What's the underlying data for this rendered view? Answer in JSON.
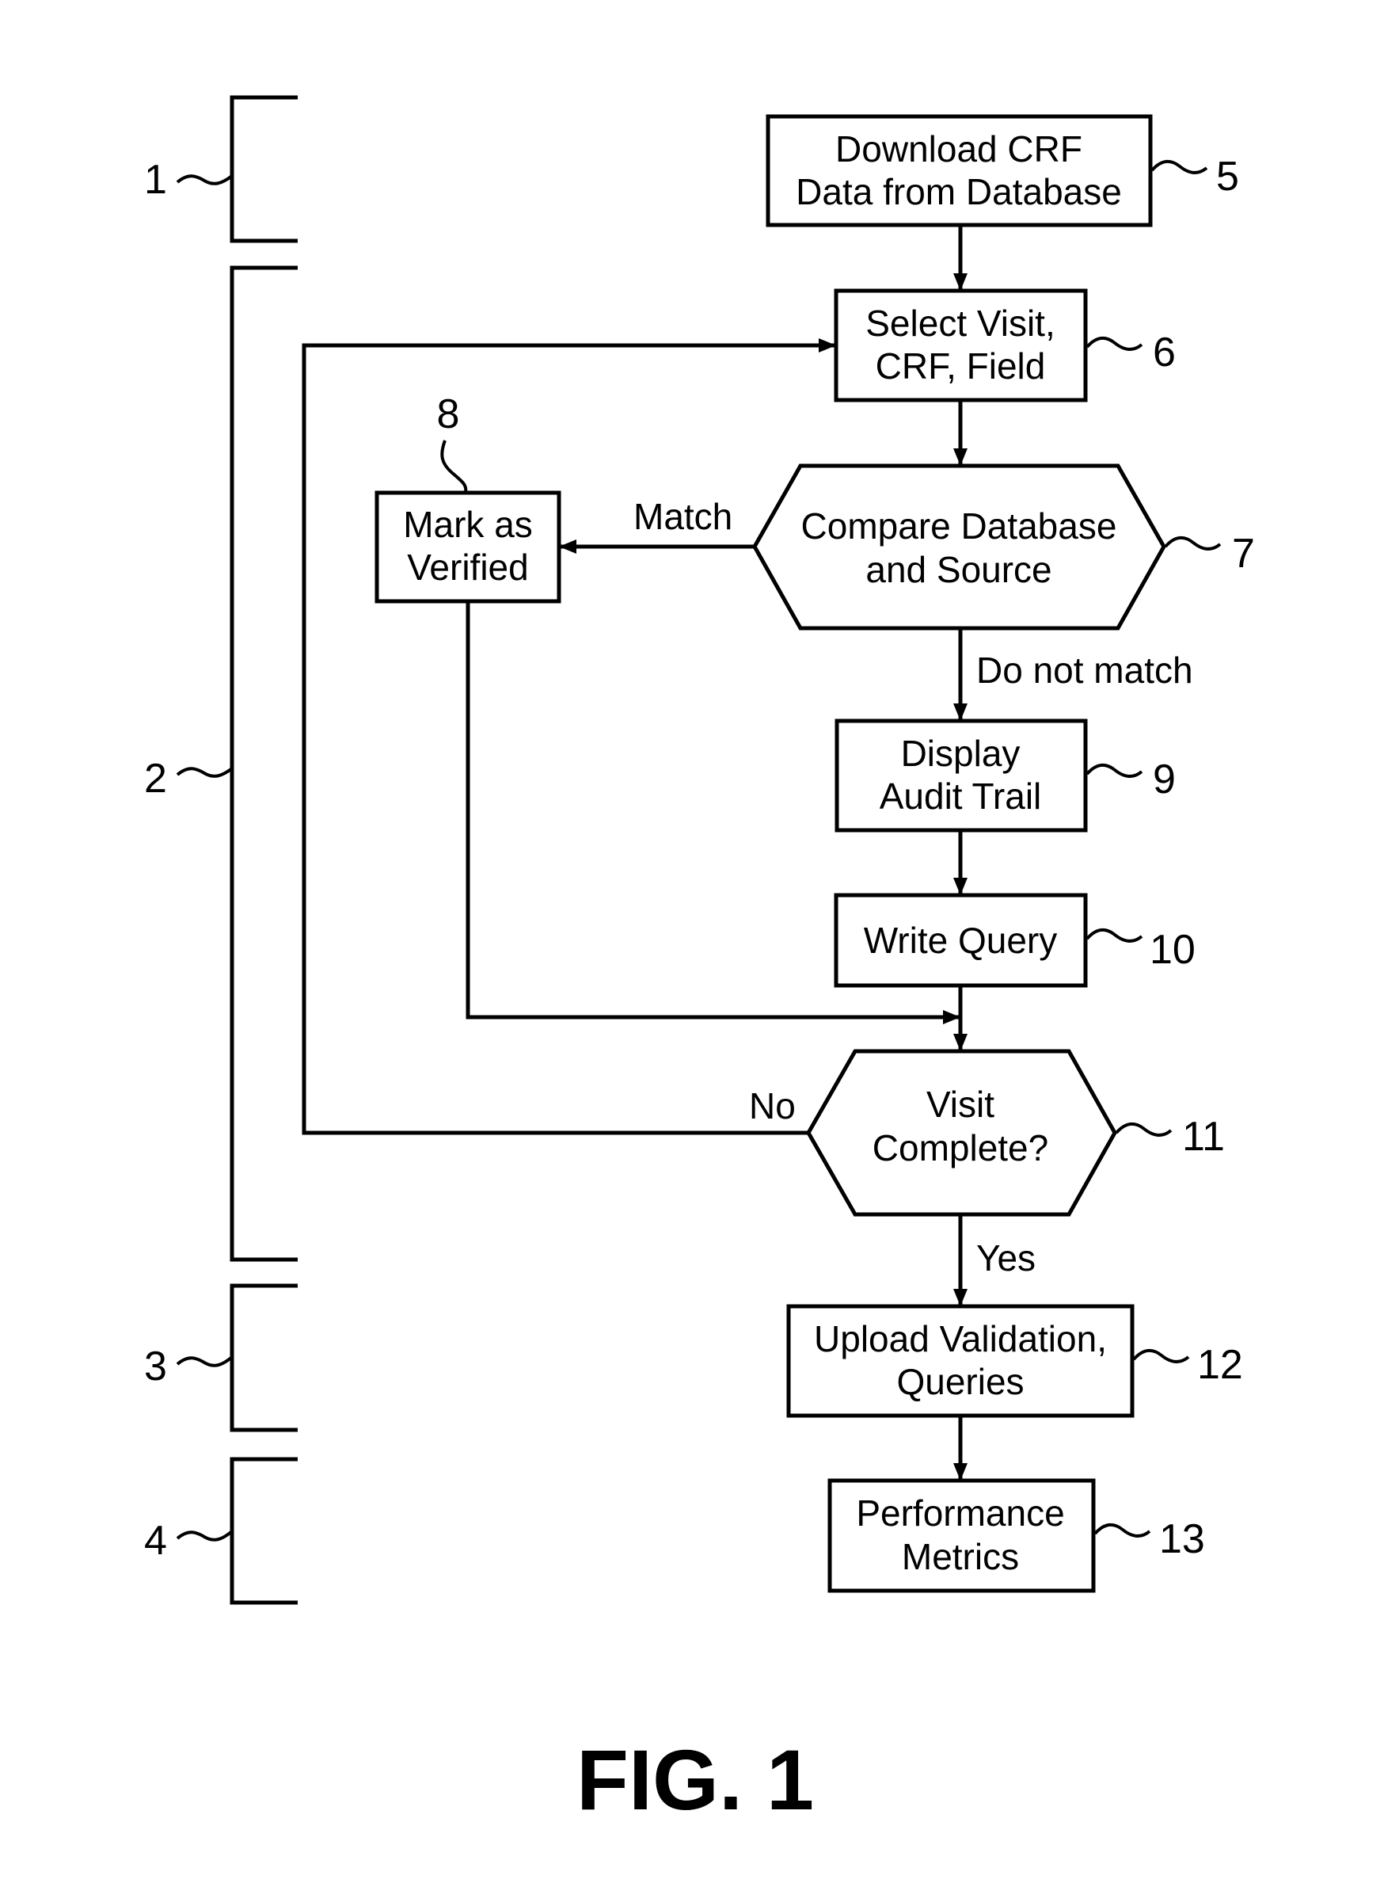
{
  "figure": {
    "title": "FIG. 1"
  },
  "phases": [
    {
      "ref": "1"
    },
    {
      "ref": "2"
    },
    {
      "ref": "3"
    },
    {
      "ref": "4"
    }
  ],
  "nodes": {
    "download": {
      "ref": "5",
      "lines": [
        "Download CRF",
        "Data from Database"
      ]
    },
    "select": {
      "ref": "6",
      "lines": [
        "Select Visit,",
        "CRF, Field"
      ]
    },
    "compare": {
      "ref": "7",
      "lines": [
        "Compare Database",
        "and Source"
      ]
    },
    "verify": {
      "ref": "8",
      "lines": [
        "Mark as",
        "Verified"
      ]
    },
    "audit": {
      "ref": "9",
      "lines": [
        "Display",
        "Audit Trail"
      ]
    },
    "query": {
      "ref": "10",
      "lines": [
        "Write Query"
      ]
    },
    "complete": {
      "ref": "11",
      "lines": [
        "Visit",
        "Complete?"
      ]
    },
    "upload": {
      "ref": "12",
      "lines": [
        "Upload Validation,",
        "Queries"
      ]
    },
    "metrics": {
      "ref": "13",
      "lines": [
        "Performance",
        "Metrics"
      ]
    }
  },
  "edges": {
    "match": "Match",
    "no_match": "Do not match",
    "no": "No",
    "yes": "Yes"
  }
}
